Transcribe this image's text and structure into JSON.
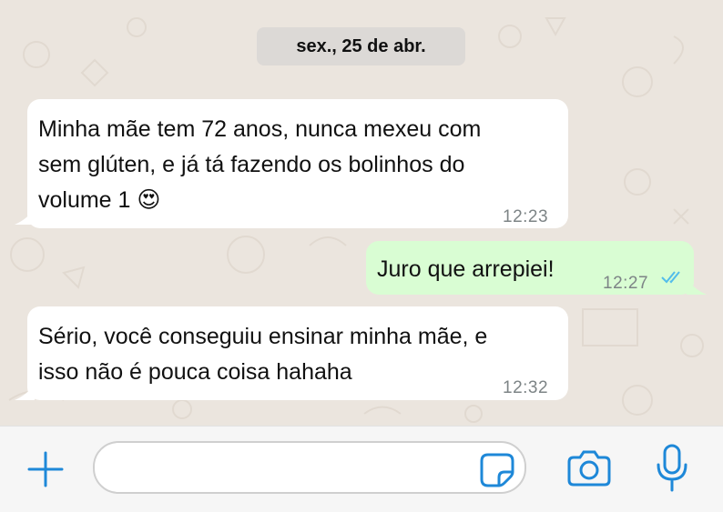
{
  "date_separator": "sex., 25 de abr.",
  "messages": [
    {
      "direction": "incoming",
      "lines": [
        "Minha mãe tem 72 anos, nunca mexeu com",
        "sem glúten, e já tá fazendo os bolinhos do",
        "volume 1"
      ],
      "emoji": "😍",
      "time": "12:23"
    },
    {
      "direction": "outgoing",
      "lines": [
        "Juro que arrepiei!"
      ],
      "time": "12:27",
      "status": "read"
    },
    {
      "direction": "incoming",
      "lines": [
        "Sério, você conseguiu ensinar minha mãe, e",
        "isso não é pouca coisa hahaha"
      ],
      "time": "12:32"
    }
  ],
  "input": {
    "value": "",
    "placeholder": ""
  },
  "icons": {
    "attach": "plus-icon",
    "sticker": "sticker-icon",
    "camera": "camera-icon",
    "mic": "microphone-icon"
  },
  "colors": {
    "accent": "#1e88d8",
    "incoming_bubble": "#ffffff",
    "outgoing_bubble": "#d9fdd3",
    "read_ticks": "#53bdeb",
    "chat_background": "#ebe5de"
  }
}
